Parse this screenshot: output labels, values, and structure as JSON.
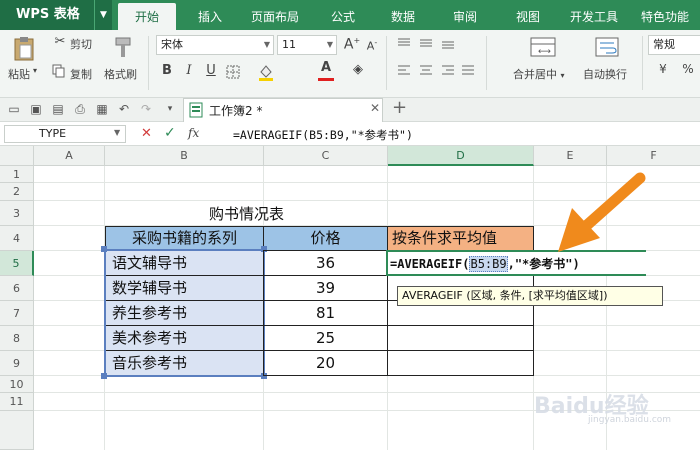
{
  "app": {
    "logo": "WPS 表格"
  },
  "tabs": [
    {
      "label": "开始",
      "active": true
    },
    {
      "label": "插入"
    },
    {
      "label": "页面布局"
    },
    {
      "label": "公式"
    },
    {
      "label": "数据"
    },
    {
      "label": "审阅"
    },
    {
      "label": "视图"
    },
    {
      "label": "开发工具"
    },
    {
      "label": "特色功能"
    }
  ],
  "ribbon": {
    "paste": "粘贴",
    "cut": "剪切",
    "copy": "复制",
    "format_painter": "格式刷",
    "font_name": "宋体",
    "font_size": "11",
    "merge_center": "合并居中",
    "wrap_text": "自动换行",
    "number_format": "常规"
  },
  "doc": {
    "tab_name": "工作簿2 *"
  },
  "formula_bar": {
    "name_box": "TYPE",
    "fx": "fx",
    "formula": "=AVERAGEIF(B5:B9,\"*参考书\")"
  },
  "columns": [
    "A",
    "B",
    "C",
    "D",
    "E",
    "F"
  ],
  "rows": [
    "1",
    "2",
    "3",
    "4",
    "5",
    "6",
    "7",
    "8",
    "9",
    "10",
    "11"
  ],
  "sheet": {
    "title": "购书情况表",
    "header_series": "采购书籍的系列",
    "header_price": "价格",
    "header_avg": "按条件求平均值",
    "items": [
      {
        "name": "语文辅导书",
        "price": "36"
      },
      {
        "name": "数学辅导书",
        "price": "39"
      },
      {
        "name": "养生参考书",
        "price": "81"
      },
      {
        "name": "美术参考书",
        "price": "25"
      },
      {
        "name": "音乐参考书",
        "price": "20"
      }
    ],
    "edit_prefix": "=AVERAGEIF(",
    "edit_ref": "B5:B9",
    "edit_suffix": ",\"*参考书\")",
    "tooltip": "AVERAGEIF (区域, 条件, [求平均值区域])"
  },
  "watermark": {
    "text": "Baidu经验",
    "sub": "jingyan.baidu.com"
  },
  "colors": {
    "green": "#2e8b57",
    "header_blue": "#9dc3e6",
    "light_blue": "#dae3f3",
    "orange": "#f4b183",
    "arrow": "#f08a1c"
  }
}
